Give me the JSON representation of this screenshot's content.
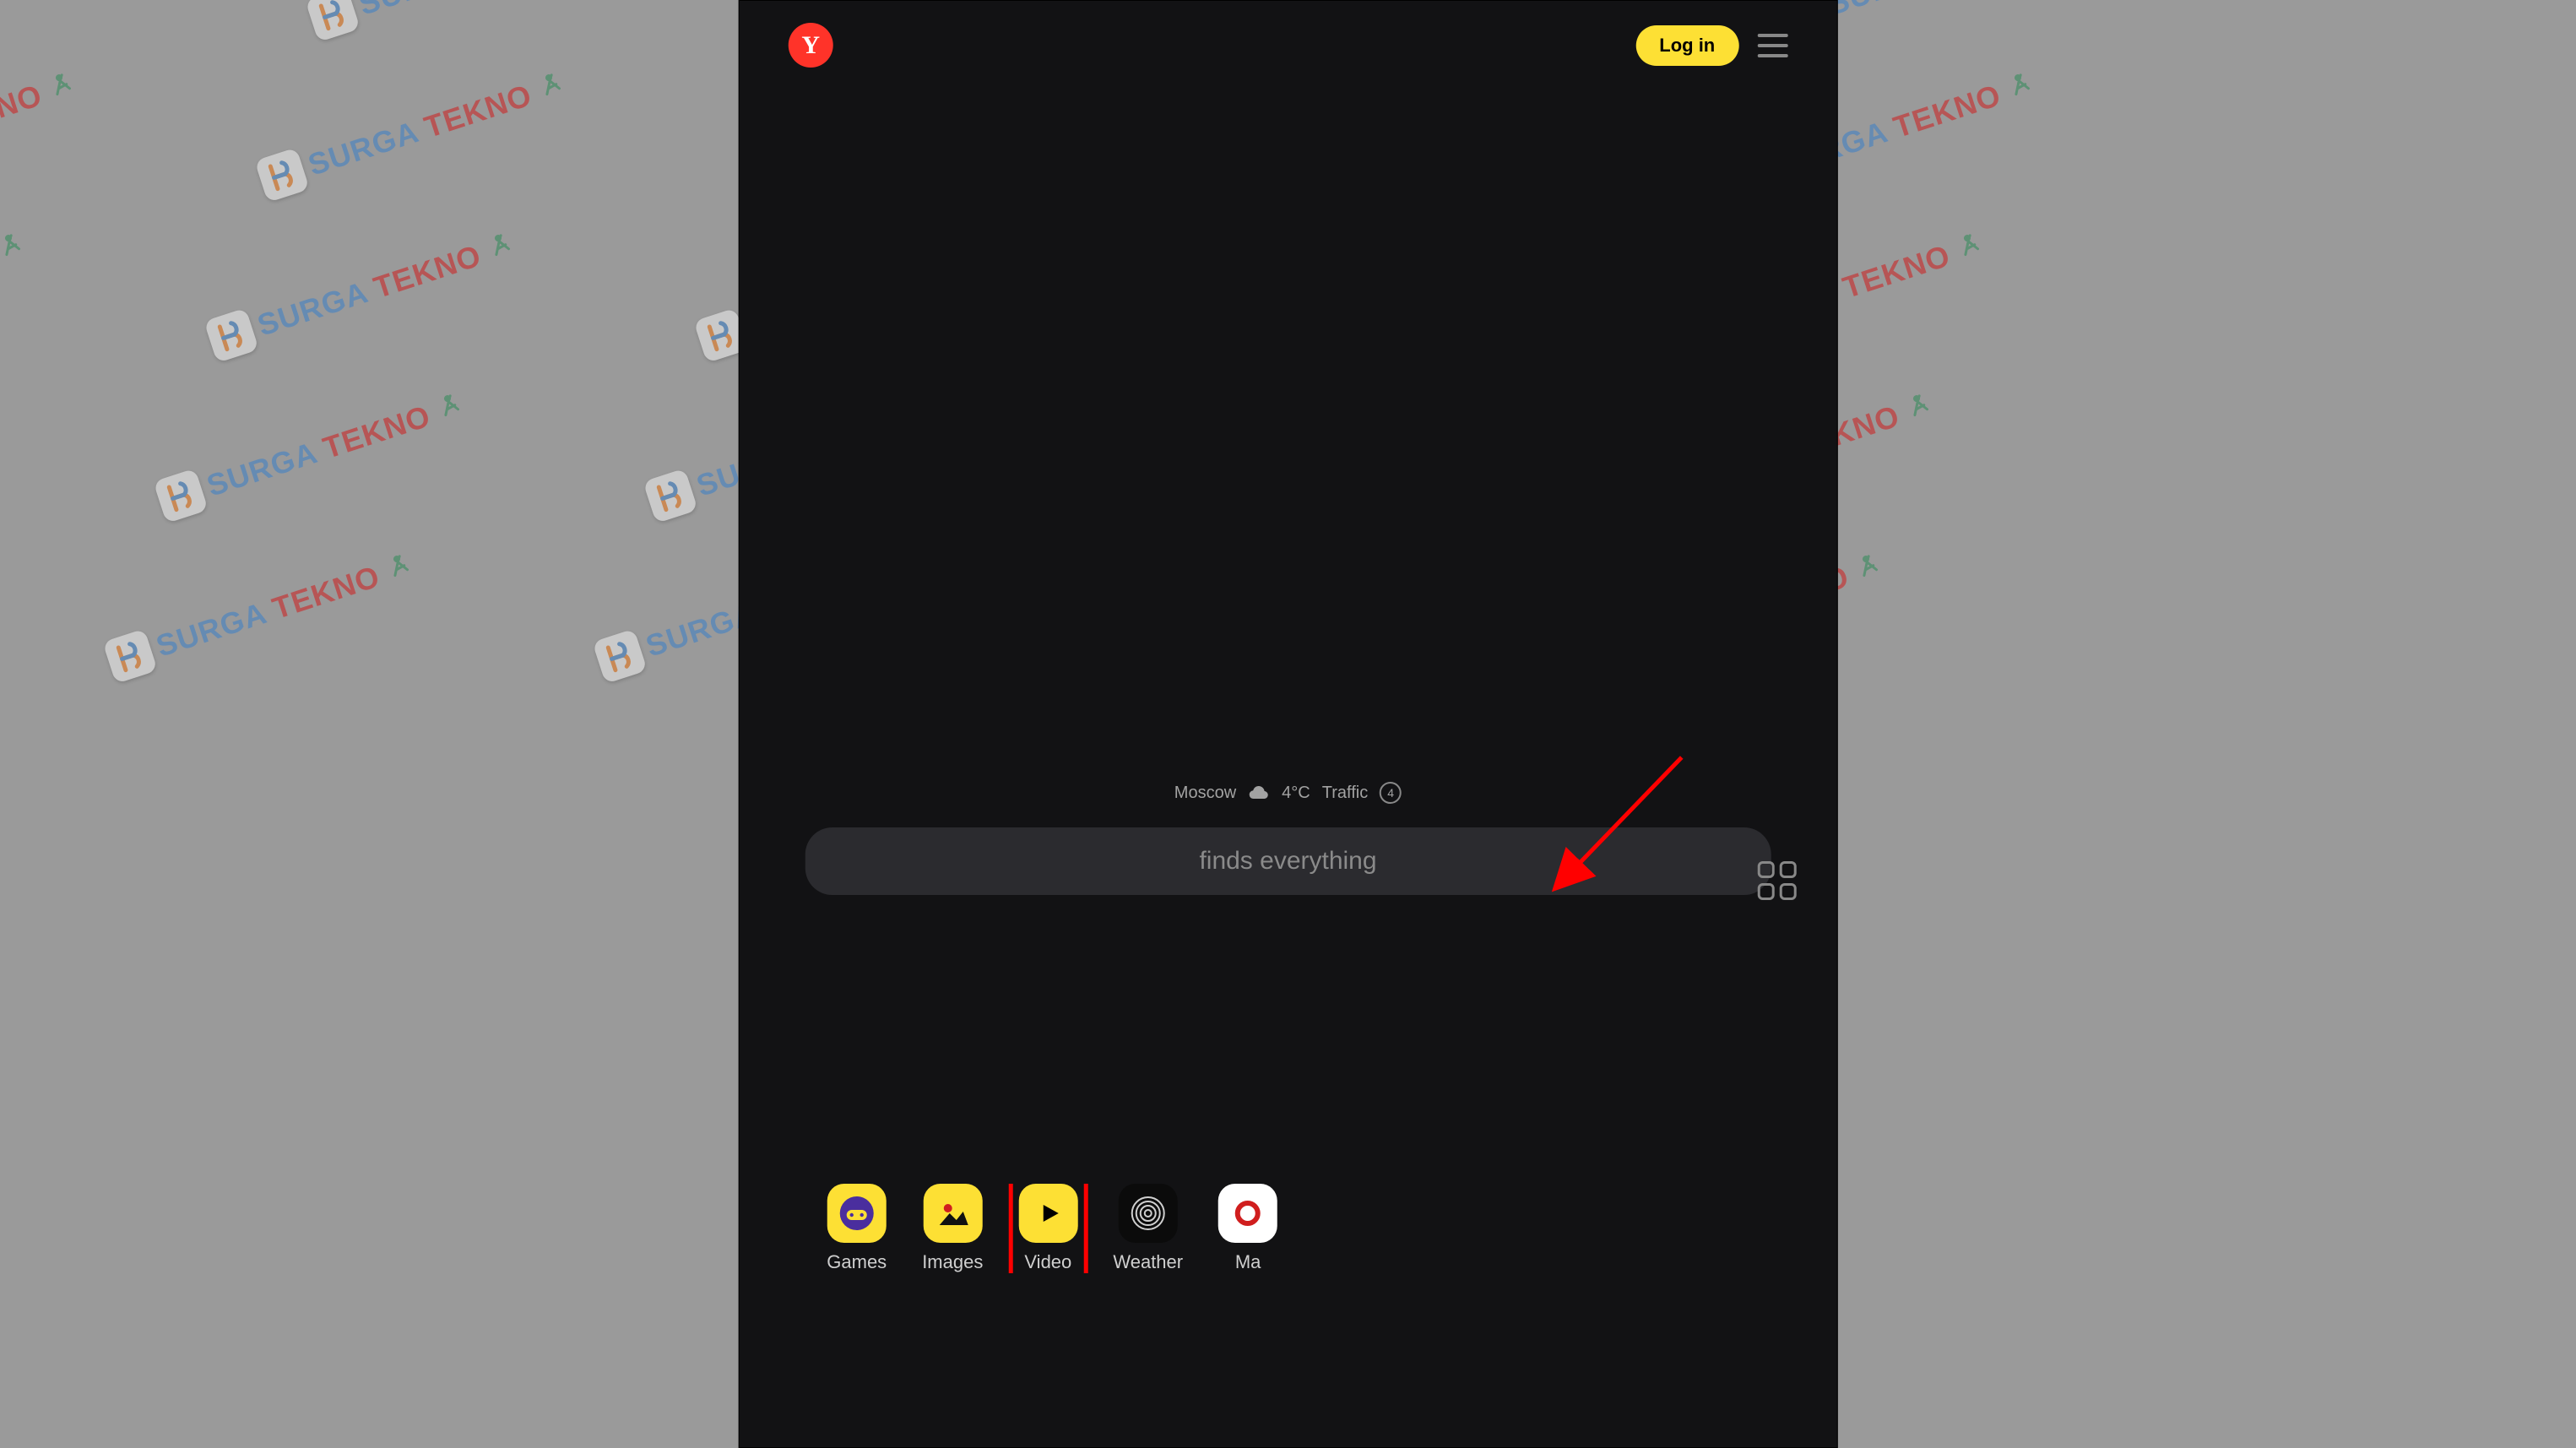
{
  "header": {
    "logo_letter": "Y",
    "login_label": "Log in"
  },
  "info": {
    "city": "Moscow",
    "temp": "4°C",
    "traffic_label": "Traffic",
    "traffic_level": "4"
  },
  "search": {
    "placeholder": "finds everything"
  },
  "shortcuts": [
    {
      "label": "Games",
      "icon": "games"
    },
    {
      "label": "Images",
      "icon": "images"
    },
    {
      "label": "Video",
      "icon": "video"
    },
    {
      "label": "Weather",
      "icon": "weather"
    },
    {
      "label": "Ma",
      "icon": "maps"
    }
  ],
  "highlight_index": 2,
  "watermark": "SURGA TEKNO"
}
